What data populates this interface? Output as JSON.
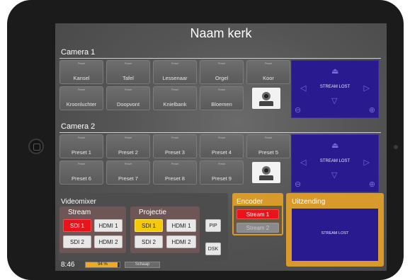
{
  "page_title": "Naam kerk",
  "camera1": {
    "label": "Camera 1",
    "presets": [
      "Kansel",
      "Tafel",
      "Lessenaar",
      "Orgel",
      "Koor",
      "Kroonluchter",
      "Doopvont",
      "Knielbank",
      "Bloemen"
    ],
    "preset_tiny": "Preset",
    "stream_status": "STREAM LOST"
  },
  "camera2": {
    "label": "Camera 2",
    "presets": [
      "Preset 1",
      "Preset 2",
      "Preset 3",
      "Preset 4",
      "Preset 5",
      "Preset 6",
      "Preset 7",
      "Preset 8",
      "Preset 9"
    ],
    "preset_tiny": "Preset",
    "stream_status": "STREAM LOST"
  },
  "videomixer": {
    "title": "Videomixer",
    "stream": {
      "label": "Stream",
      "buttons": [
        "SDI 1",
        "HDMI 1",
        "SDI 2",
        "HDMI 2"
      ]
    },
    "projectie": {
      "label": "Projectie",
      "buttons": [
        "SDI 1",
        "HDMI 1",
        "SDI 2",
        "HDMI 2"
      ]
    },
    "pip_label": "PIP",
    "dsk_label": "DSK"
  },
  "encoder": {
    "title": "Encoder",
    "stream1_label": "Stream 1",
    "stream2_label": "Stream 2"
  },
  "uitzending": {
    "title": "Uitzending",
    "stream_status": "STREAM LOST"
  },
  "status": {
    "time": "8:46",
    "progress_label": "94 %",
    "progress_value": 0.94,
    "scene_label": "Schaap"
  },
  "colors": {
    "accent_orange": "#d89a2c",
    "active_red": "#e8141a",
    "active_yellow": "#f5c90a",
    "video_blue": "#2a1a8f"
  }
}
